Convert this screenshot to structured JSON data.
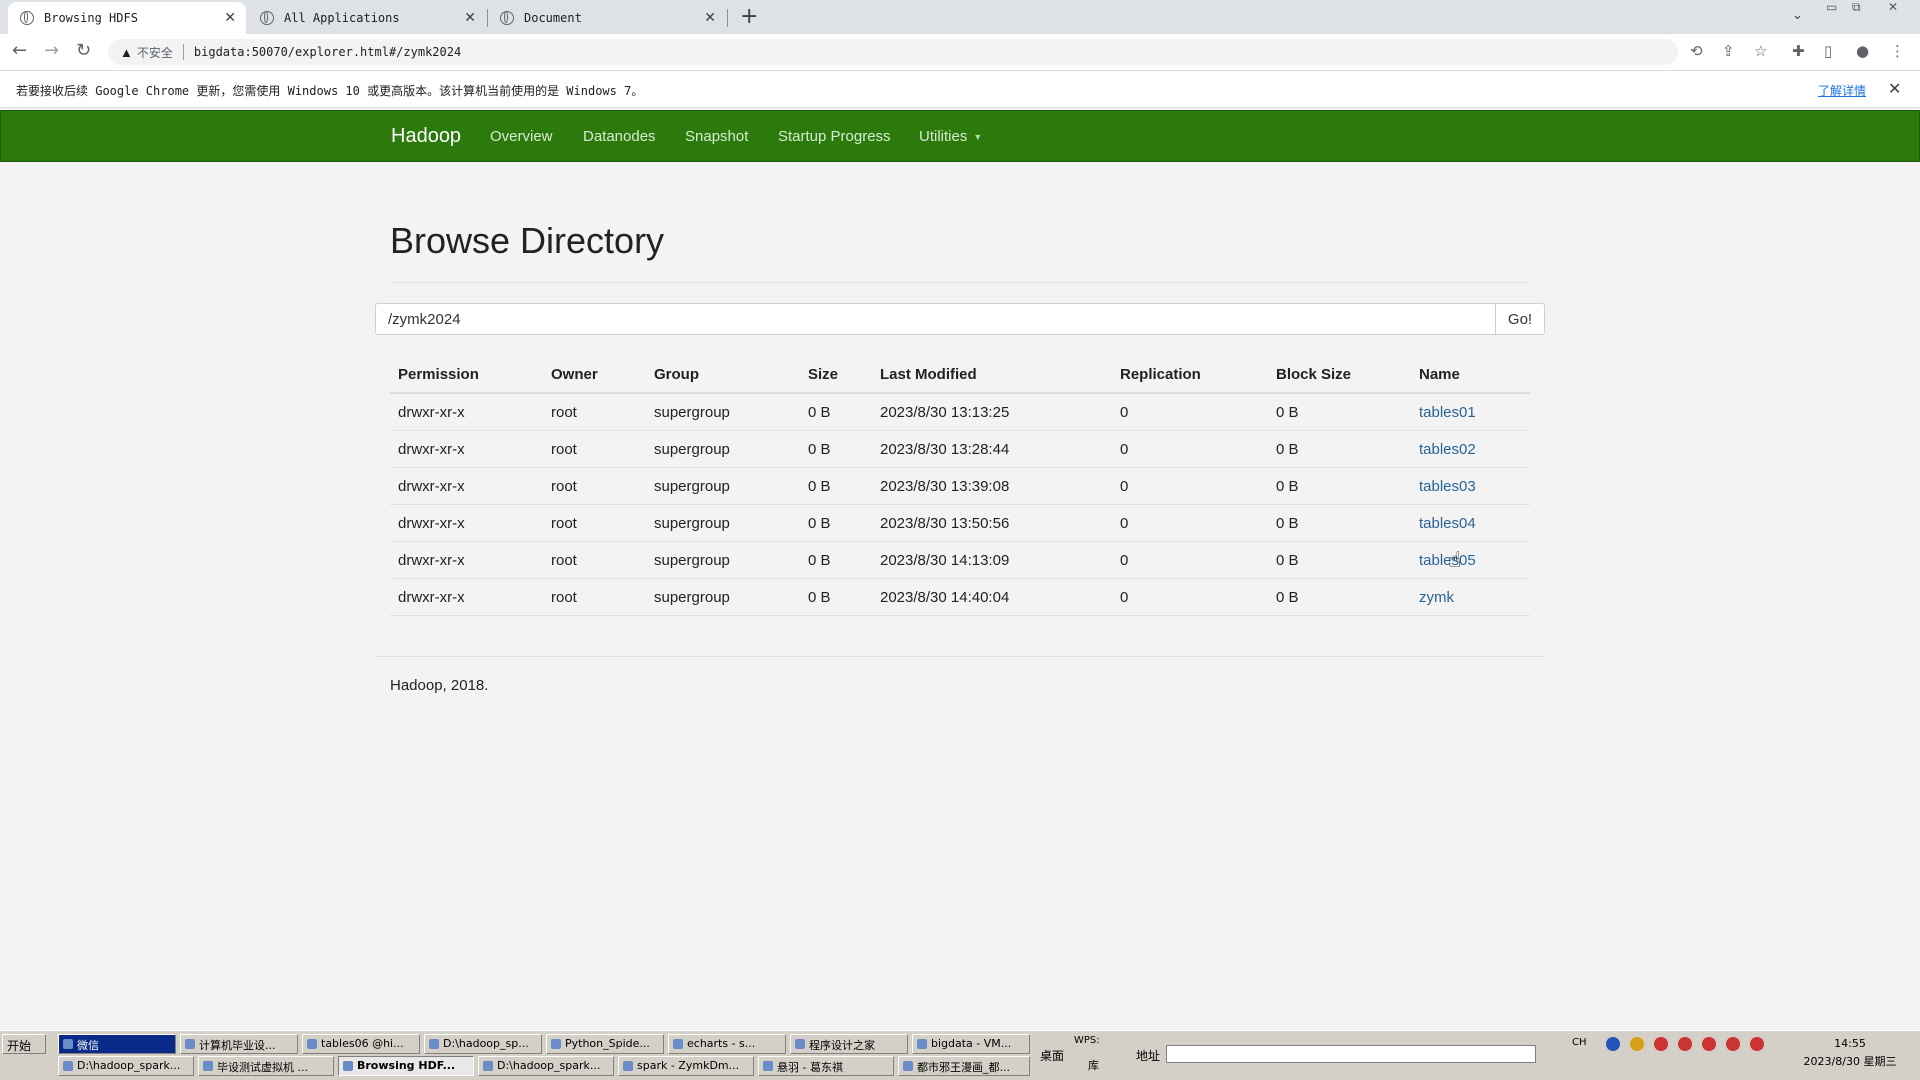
{
  "browser": {
    "tabs": [
      {
        "label": "Browsing HDFS",
        "active": true
      },
      {
        "label": "All Applications",
        "active": false
      },
      {
        "label": "Document",
        "active": false
      }
    ],
    "omnibox": {
      "insecure_label": "不安全",
      "url": "bigdata:50070/explorer.html#/zymk2024"
    },
    "infobar": {
      "message": "若要接收后续 Google Chrome 更新，您需使用 Windows 10 或更高版本。该计算机当前使用的是 Windows 7。",
      "learn_more": "了解详情"
    }
  },
  "navbar": {
    "brand": "Hadoop",
    "links": [
      "Overview",
      "Datanodes",
      "Snapshot",
      "Startup Progress",
      "Utilities"
    ]
  },
  "page": {
    "title": "Browse Directory",
    "path_value": "/zymk2024",
    "go_label": "Go!",
    "footer": "Hadoop, 2018."
  },
  "table": {
    "headers": [
      "Permission",
      "Owner",
      "Group",
      "Size",
      "Last Modified",
      "Replication",
      "Block Size",
      "Name"
    ],
    "rows": [
      [
        "drwxr-xr-x",
        "root",
        "supergroup",
        "0 B",
        "2023/8/30 13:13:25",
        "0",
        "0 B",
        "tables01"
      ],
      [
        "drwxr-xr-x",
        "root",
        "supergroup",
        "0 B",
        "2023/8/30 13:28:44",
        "0",
        "0 B",
        "tables02"
      ],
      [
        "drwxr-xr-x",
        "root",
        "supergroup",
        "0 B",
        "2023/8/30 13:39:08",
        "0",
        "0 B",
        "tables03"
      ],
      [
        "drwxr-xr-x",
        "root",
        "supergroup",
        "0 B",
        "2023/8/30 13:50:56",
        "0",
        "0 B",
        "tables04"
      ],
      [
        "drwxr-xr-x",
        "root",
        "supergroup",
        "0 B",
        "2023/8/30 14:13:09",
        "0",
        "0 B",
        "tables05"
      ],
      [
        "drwxr-xr-x",
        "root",
        "supergroup",
        "0 B",
        "2023/8/30 14:40:04",
        "0",
        "0 B",
        "zymk"
      ]
    ]
  },
  "taskbar": {
    "start": "开始",
    "row1": [
      "微信",
      "计算机毕业设...",
      "tables06 @hi...",
      "D:\\hadoop_sp...",
      "Python_Spide...",
      "echarts - s...",
      "程序设计之家",
      "bigdata - VM..."
    ],
    "row2": [
      "D:\\hadoop_spark...",
      "毕设测试虚拟机 ...",
      "Browsing HDF...",
      "D:\\hadoop_spark...",
      "spark - ZymkDm...",
      "悬羽 - 葛东祺",
      "都市邪王漫画_都..."
    ],
    "desktop": "桌面",
    "wps": "WPS:",
    "library": "库",
    "address_label": "地址",
    "lang": "CH",
    "time": "14:55",
    "date": "2023/8/30 星期三"
  }
}
